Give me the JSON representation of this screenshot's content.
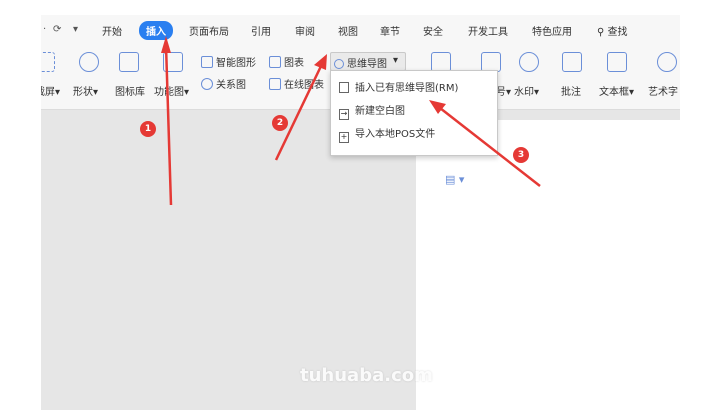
{
  "menubar": {
    "undo_icon": "undo-icon",
    "dropdown_icon": "chevron-down-icon",
    "items": [
      "开始",
      "插入",
      "页面布局",
      "引用",
      "审阅",
      "视图",
      "章节",
      "安全",
      "开发工具",
      "特色应用"
    ],
    "active": "插入",
    "search_label": "查找"
  },
  "ribbon": {
    "screenshot_label": "截屏",
    "shape_label": "形状",
    "icon_lib_label": "图标库",
    "func_label": "功能图",
    "smart_shape_label": "智能图形",
    "chart_label": "图表",
    "relation_label": "关系图",
    "online_chart_label": "在线图表",
    "mindmap_label": "思维导图",
    "watermark_label": "水印",
    "comment_label": "批注",
    "textbox_label": "文本框",
    "art_label": "艺术字"
  },
  "dropdown": {
    "items": [
      "插入已有思维导图(RM)",
      "新建空白图",
      "导入本地POS文件"
    ]
  },
  "annotations": {
    "badges": [
      "1",
      "2",
      "3"
    ],
    "arrow_color": "#e53935"
  },
  "watermark_text": "tuhuaba.com",
  "colors": {
    "accent": "#2a7ff0",
    "annotation": "#e53935",
    "icon": "#6b8fd8"
  }
}
